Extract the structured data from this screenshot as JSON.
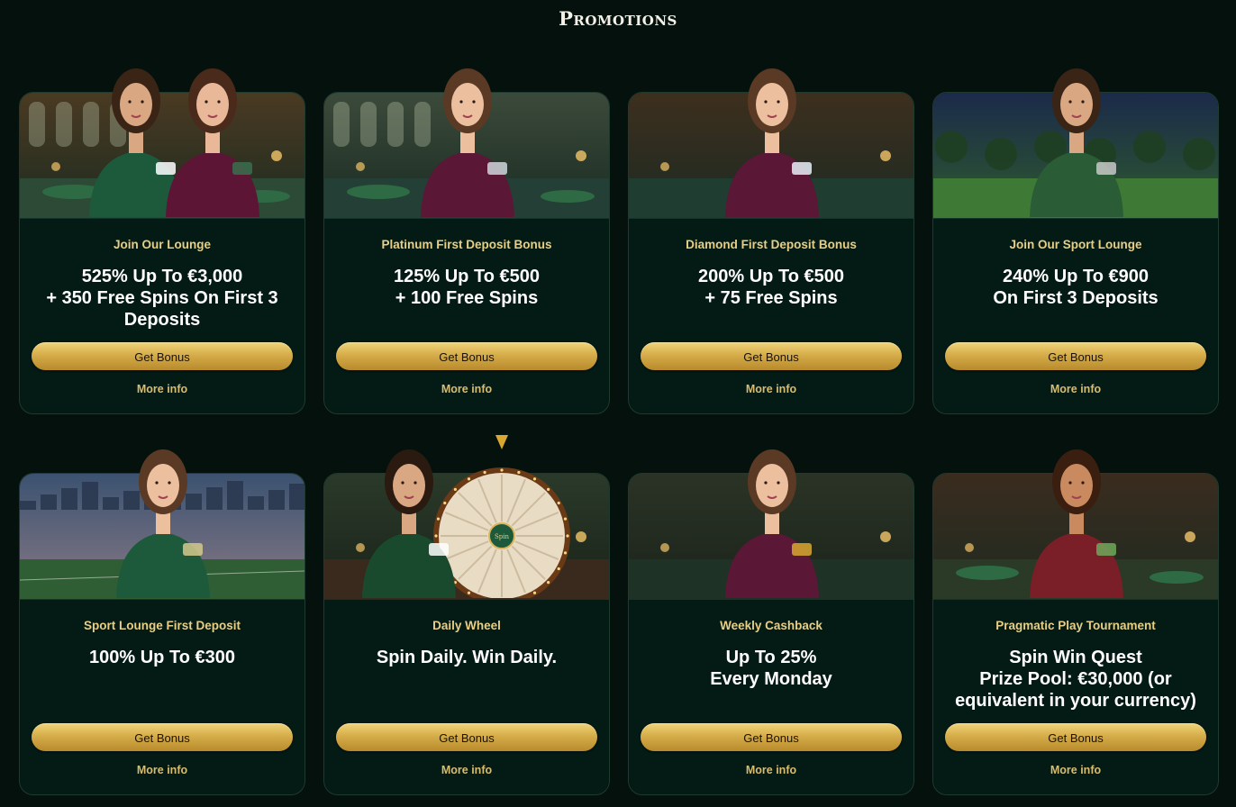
{
  "page": {
    "title": "Promotions"
  },
  "colors": {
    "background": "#04110d",
    "card": "#041a14",
    "gold": "#e8cf86",
    "button": "#d6ad4a"
  },
  "promotions": [
    {
      "name": "Join Our Lounge",
      "offer": [
        "525% Up To €3,000",
        "+ 350 Free Spins On First 3",
        "Deposits"
      ],
      "cta": "Get Bonus",
      "link": "More info",
      "art": "couple-tuxedo-lounge"
    },
    {
      "name": "Platinum First Deposit Bonus",
      "offer": [
        "125% Up To €500",
        "+ 100 Free Spins"
      ],
      "cta": "Get Bonus",
      "link": "More info",
      "art": "woman-platinum-card"
    },
    {
      "name": "Diamond First Deposit Bonus",
      "offer": [
        "200% Up To €500",
        "+ 75 Free Spins"
      ],
      "cta": "Get Bonus",
      "link": "More info",
      "art": "woman-diamond-armchair"
    },
    {
      "name": "Join Our Sport Lounge",
      "offer": [
        "240% Up To €900",
        "On First 3 Deposits"
      ],
      "cta": "Get Bonus",
      "link": "More info",
      "art": "golfer-night-course"
    },
    {
      "name": "Sport Lounge First Deposit",
      "offer": [
        "100% Up To €300"
      ],
      "cta": "Get Bonus",
      "link": "More info",
      "art": "woman-tennis-racket"
    },
    {
      "name": "Daily Wheel",
      "offer": [
        "Spin Daily. Win Daily."
      ],
      "cta": "Get Bonus",
      "link": "More info",
      "art": "man-prize-wheel",
      "wheel_label": "Spin"
    },
    {
      "name": "Weekly Cashback",
      "offer": [
        "Up To 25%",
        "Every Monday"
      ],
      "cta": "Get Bonus",
      "link": "More info",
      "art": "woman-gold-bar"
    },
    {
      "name": "Pragmatic Play Tournament",
      "offer": [
        "Spin Win Quest",
        "Prize Pool: €30,000 (or",
        "equivalent in your currency)"
      ],
      "cta": "Get Bonus",
      "link": "More info",
      "art": "man-cash-red-suit"
    }
  ]
}
